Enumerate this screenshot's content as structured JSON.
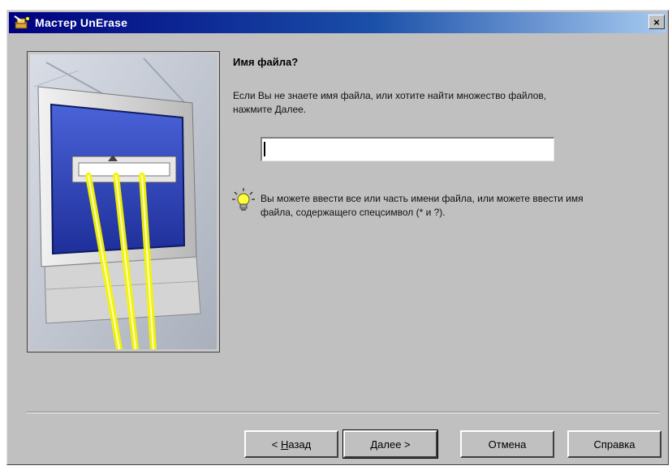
{
  "window": {
    "title": "Мастер UnErase",
    "close_label": "×"
  },
  "icons": {
    "app": "wizard-app-icon",
    "close": "close-icon",
    "tip": "lightbulb-icon",
    "illustration": "computer-monitor-illustration"
  },
  "main": {
    "heading": "Имя файла?",
    "description": "Если Вы не знаете имя файла, или хотите найти множество файлов, нажмите Далее.",
    "filename_value": "",
    "tip": "Вы можете ввести все или часть имени файла, или можете ввести имя файла, содержащего спецсимвол (* и ?)."
  },
  "buttons": {
    "back_prefix": "< ",
    "back_mnemonic": "Н",
    "back_rest": "азад",
    "next": "Далее >",
    "cancel": "Отмена",
    "help": "Справка"
  },
  "colors": {
    "title_start": "#000080",
    "title_end": "#a6caf0",
    "dialog_bg": "#c0c0c0",
    "monitor_screen": "#2b3fb0",
    "light_beams": "#f5f500"
  }
}
